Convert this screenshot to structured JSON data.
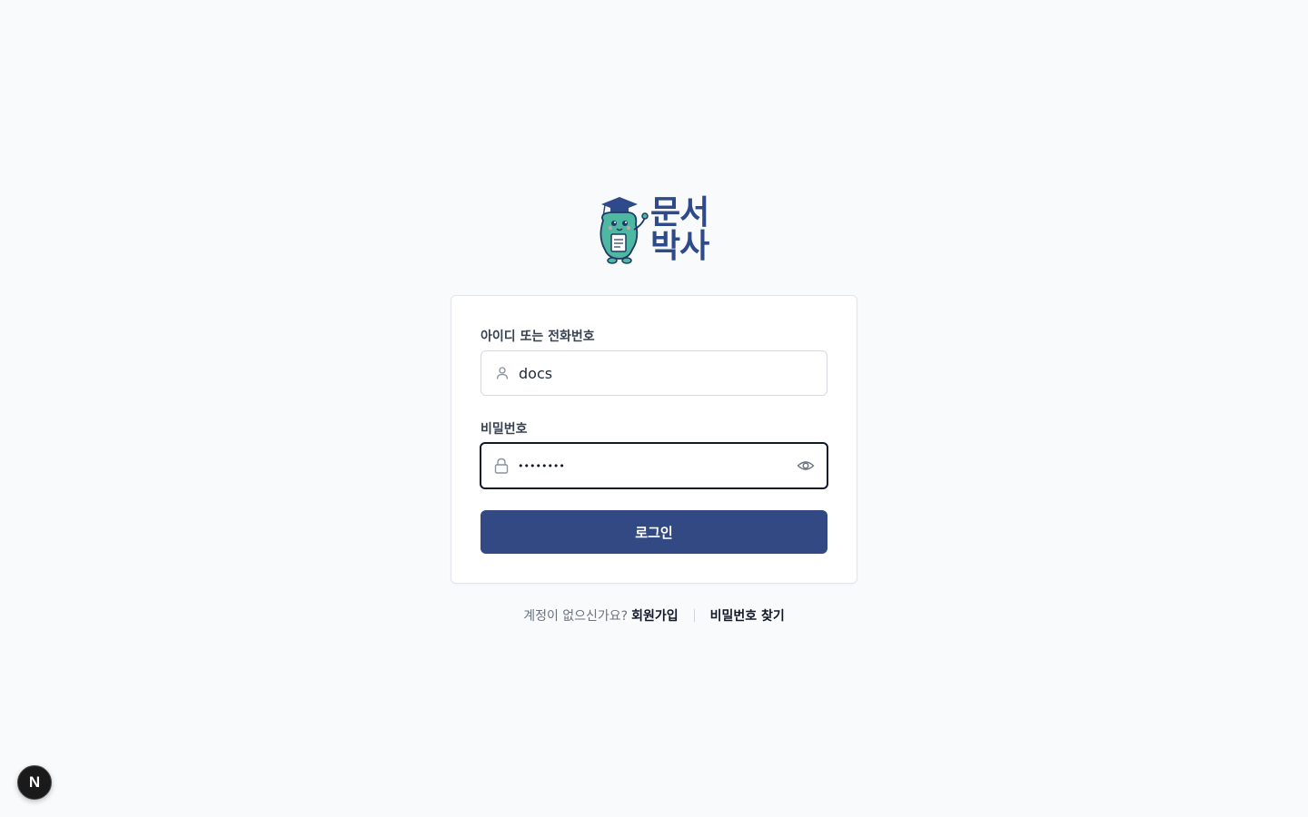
{
  "logo": {
    "line1": "문서",
    "line2": "박사",
    "brand_color": "#2e4a8a",
    "mascot_icon": "mascot-graduate-icon"
  },
  "login_form": {
    "id_label": "아이디 또는 전화번호",
    "id_value": "docs",
    "id_icon": "user-icon",
    "password_label": "비밀번호",
    "password_value": "••••••••",
    "password_icon": "lock-icon",
    "toggle_icon": "eye-icon",
    "submit_label": "로그인",
    "submit_color": "#324984"
  },
  "footer": {
    "no_account_text": "계정이 없으신가요?",
    "signup_label": "회원가입",
    "find_password_label": "비밀번호 찾기"
  },
  "dev_badge": {
    "label": "N",
    "icon": "nextjs-icon"
  }
}
